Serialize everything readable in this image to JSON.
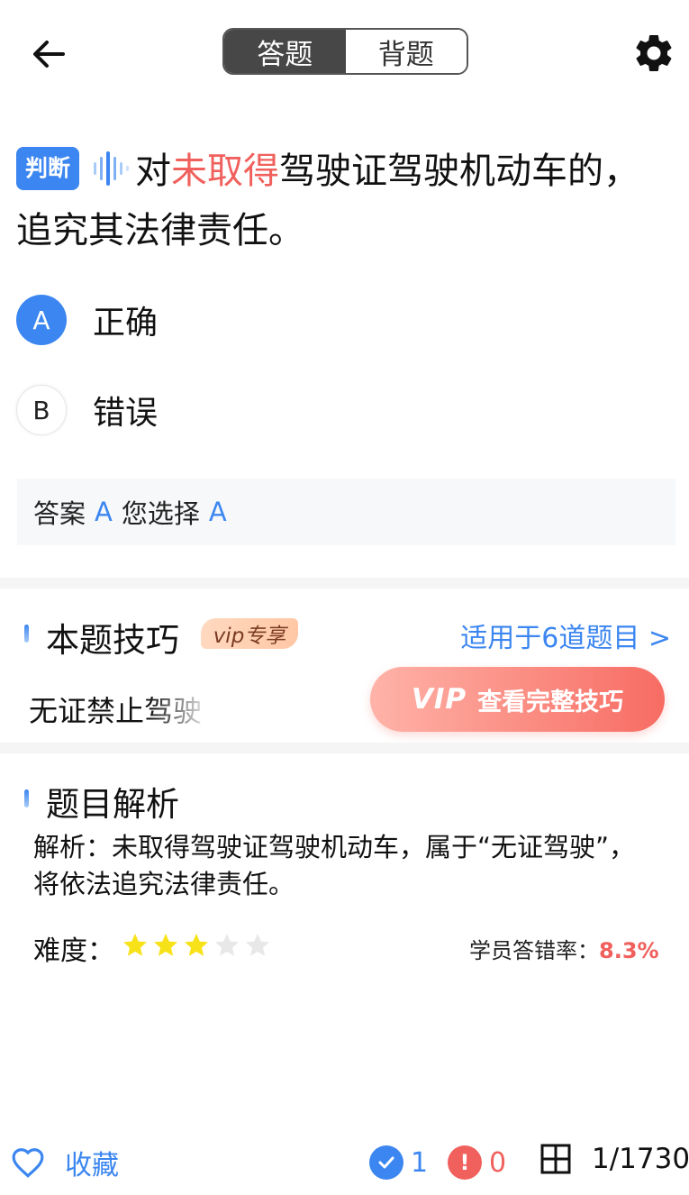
{
  "header": {
    "tabs": [
      "答题",
      "背题"
    ],
    "active_tab": 0
  },
  "question": {
    "type_tag": "判断",
    "text_before": "对",
    "highlight": "未取得",
    "text_after": "驾驶证驾驶机动车的，追究其法律责任。"
  },
  "options": [
    {
      "letter": "A",
      "text": "正确",
      "selected": true
    },
    {
      "letter": "B",
      "text": "错误",
      "selected": false
    }
  ],
  "answer": {
    "label": "答案",
    "correct": "A",
    "your_label": "您选择",
    "yours": "A"
  },
  "tips": {
    "title": "本题技巧",
    "vip_badge": "vip专享",
    "link": "适用于6道题目 >",
    "preview": "无证禁止驾驶",
    "vip_logo": "VIP",
    "vip_button": "查看完整技巧"
  },
  "analysis": {
    "title": "题目解析",
    "text": "解析：未取得驾驶证驾驶机动车，属于“无证驾驶”，将依法追究法律责任。",
    "difficulty_label": "难度：",
    "difficulty": 3,
    "difficulty_max": 5,
    "error_rate_label": "学员答错率：",
    "error_rate": "8.3%"
  },
  "bottom": {
    "favorite": "收藏",
    "correct_count": "1",
    "wrong_count": "0",
    "progress": "1/1730"
  },
  "colors": {
    "accent": "#3b86f0",
    "highlight": "#f0605c",
    "star_on": "#f7e21a",
    "star_off": "#e8e8e8"
  }
}
